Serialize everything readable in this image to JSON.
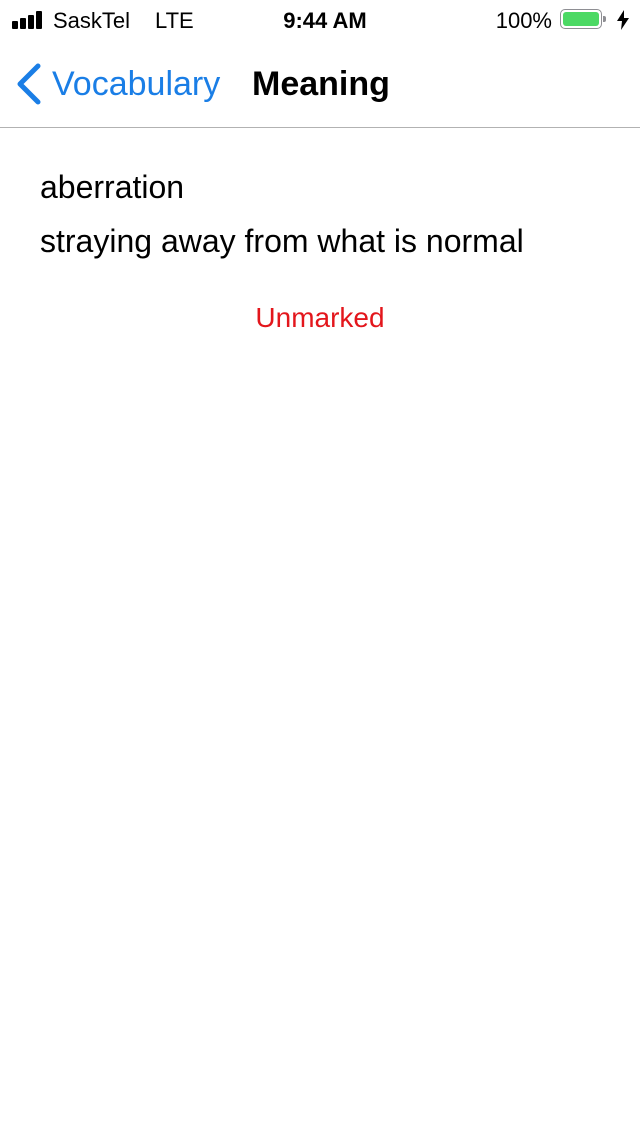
{
  "status_bar": {
    "carrier": "SaskTel",
    "network": "LTE",
    "time": "9:44 AM",
    "battery_percent_label": "100%",
    "battery_level": 1.0,
    "signal_bars": 4,
    "signal_icon": "cellular-signal-icon",
    "battery_icon": "battery-icon",
    "charging_icon": "lightning-bolt-icon",
    "battery_color": "#4cd964"
  },
  "nav": {
    "back_label": "Vocabulary",
    "back_icon": "chevron-left-icon",
    "title": "Meaning",
    "accent_color": "#1a7ee6"
  },
  "content": {
    "word": "aberration",
    "definition": "straying away from what is normal",
    "mark_status": "Unmarked",
    "mark_color": "#e3161c"
  }
}
